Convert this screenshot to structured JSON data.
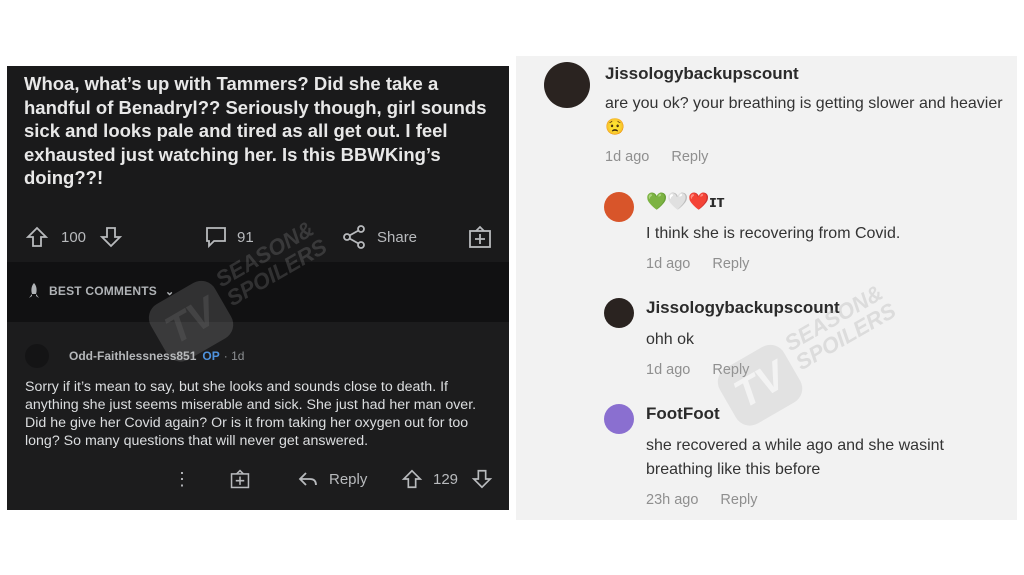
{
  "reddit": {
    "post_text": "Whoa, what’s up with Tammers? Did she take a handful of Benadryl?? Seriously though, girl sounds sick and looks pale and tired as all get out. I feel exhausted just watching her. Is this BBWKing’s doing??!",
    "upvotes": "100",
    "comments_count": "91",
    "share_label": "Share",
    "best_comments_label": "BEST COMMENTS",
    "comment": {
      "username": "Odd-Faithlessness851",
      "op_label": "OP",
      "time": "· 1d",
      "body": "Sorry if it’s mean to say, but she looks and sounds close to death. If anything she just seems miserable and sick. She just had her man over. Did he give her Covid again? Or is it from taking her oxygen out for too long? So many questions that will never get answered.",
      "more_label": "⋮",
      "reply_label": "Reply",
      "votes": "129"
    }
  },
  "watermark": {
    "logo": "TV",
    "line1": "SEASON&",
    "line2": "SPOILERS"
  },
  "tiktok": {
    "comments": [
      {
        "username": "Jissologybackupscount",
        "text": "are you ok? your breathing is getting slower and heavier 😟",
        "time": "1d ago",
        "reply": "Reply",
        "avatar_color": "#2a2320"
      },
      {
        "username": "💚🤍❤️ɪт",
        "text": "I think she is recovering from Covid.",
        "time": "1d ago",
        "reply": "Reply",
        "avatar_color": "#d8552a"
      },
      {
        "username": "Jissologybackupscount",
        "text": "ohh ok",
        "time": "1d ago",
        "reply": "Reply",
        "avatar_color": "#2a2320"
      },
      {
        "username": "FootFoot",
        "text": "she recovered a while ago and she wasint breathing like this before",
        "time": "23h ago",
        "reply": "Reply",
        "avatar_color": "#8a6fd0"
      }
    ]
  }
}
